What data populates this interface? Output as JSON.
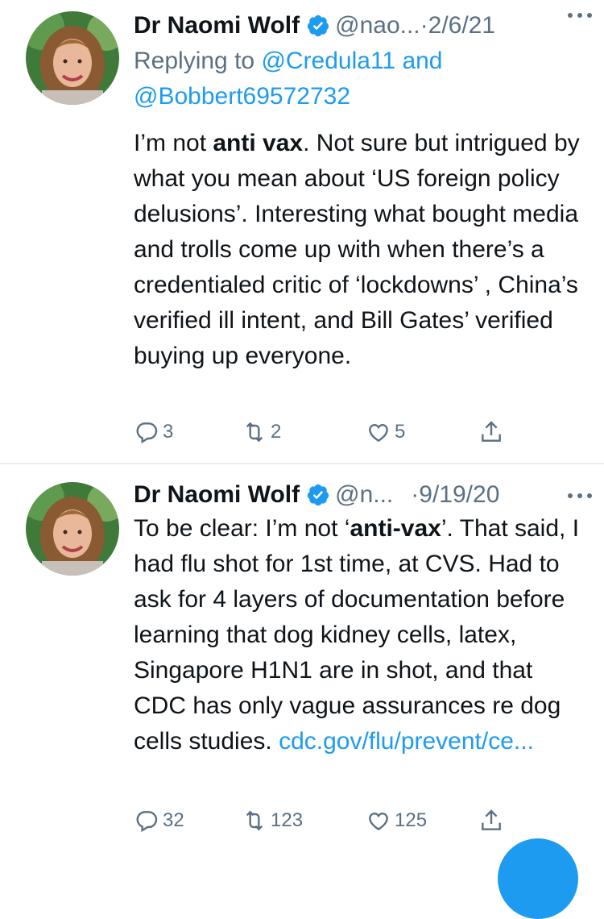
{
  "tweets": [
    {
      "author_name": "Dr Naomi Wolf",
      "handle": "@nao...",
      "separator": "·",
      "date": "2/6/21",
      "replying_label": "Replying to",
      "replying_mention1": "@Credula11",
      "replying_and": "and",
      "replying_mention2": "@Bobbert69572732",
      "text_pre": "I’m not ",
      "text_bold": "anti vax",
      "text_post": ". Not sure but intrigued by what you mean about ‘US foreign policy delusions’. Interesting what bought media and trolls come up with when there’s a credentialed critic of ‘lockdowns’ , China’s verified ill intent, and Bill Gates’ verified buying up everyone.",
      "replies": "3",
      "retweets": "2",
      "likes": "5"
    },
    {
      "author_name": "Dr Naomi Wolf",
      "handle": "@n...",
      "separator": "·",
      "date": "9/19/20",
      "text_pre": "To be clear: I’m not ‘",
      "text_bold": "anti-vax",
      "text_post": "’. That said, I had flu shot for 1st time, at CVS. Had to ask for 4 layers of documentation before learning that dog kidney cells, latex, Singapore H1N1 are in shot, and that CDC has only vague assurances re dog cells studies. ",
      "link_text": "cdc.gov/flu/prevent/ce...",
      "replies": "32",
      "retweets": "123",
      "likes": "125"
    }
  ],
  "colors": {
    "link": "#1d9bf0",
    "secondary_text": "#5b7083",
    "verified": "#1d9bf0"
  },
  "icons": [
    "verified-badge-icon",
    "more-icon",
    "reply-icon",
    "retweet-icon",
    "like-icon",
    "share-icon"
  ]
}
